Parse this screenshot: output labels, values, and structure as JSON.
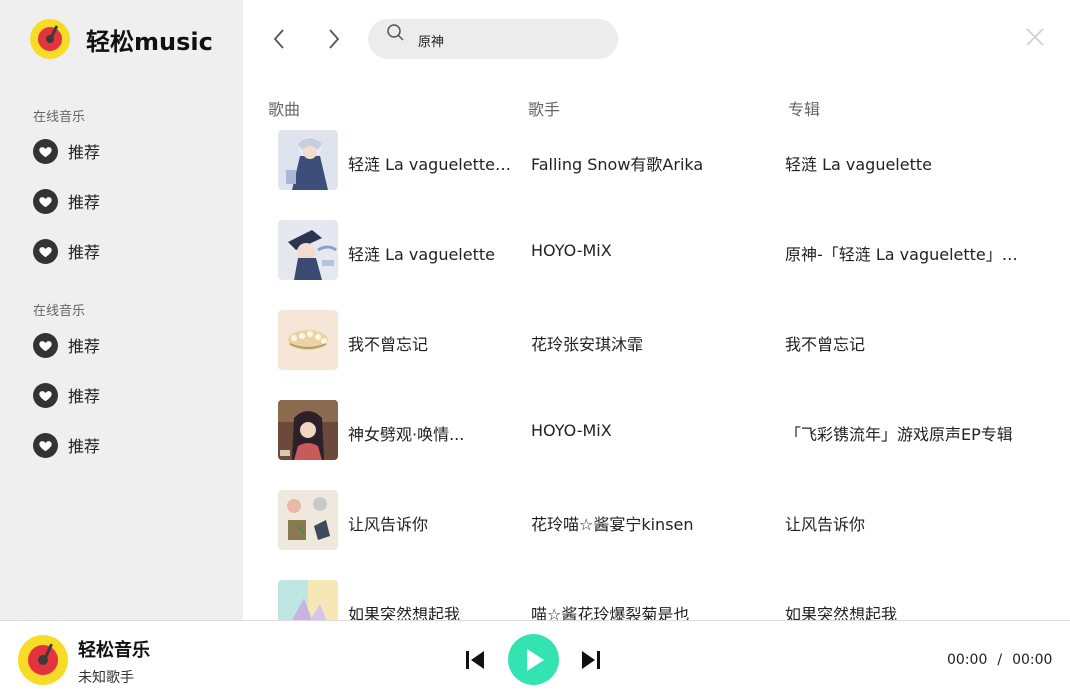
{
  "app": {
    "name": "轻松music"
  },
  "sidebar": {
    "sections": [
      {
        "title": "在线音乐",
        "items": [
          {
            "label": "推荐"
          },
          {
            "label": "推荐"
          },
          {
            "label": "推荐"
          }
        ]
      },
      {
        "title": "在线音乐",
        "items": [
          {
            "label": "推荐"
          },
          {
            "label": "推荐"
          },
          {
            "label": "推荐"
          }
        ]
      }
    ]
  },
  "search": {
    "value": "原神",
    "placeholder": ""
  },
  "table": {
    "headers": {
      "song": "歌曲",
      "artist": "歌手",
      "album": "专辑"
    },
    "rows": [
      {
        "song": "轻涟 La vaguelette法...",
        "artist": "Falling Snow有歌Arika",
        "album": "轻涟 La vaguelette"
      },
      {
        "song": "轻涟 La vaguelette",
        "artist": "HOYO-MiX",
        "album": "原神-「轻涟 La vaguelette」游..."
      },
      {
        "song": "我不曾忘记",
        "artist": "花玲张安琪沐霏",
        "album": "我不曾忘记"
      },
      {
        "song": "神女劈观·唤情...",
        "artist": "HOYO-MiX",
        "album": "「飞彩镌流年」游戏原声EP专辑"
      },
      {
        "song": "让风告诉你",
        "artist": "花玲喵☆酱宴宁kinsen",
        "album": "让风告诉你"
      },
      {
        "song": "如果突然想起我",
        "artist": "喵☆酱花玲爆裂菊是也",
        "album": "如果突然想起我"
      }
    ]
  },
  "player": {
    "title": "轻松音乐",
    "artist": "未知歌手",
    "current_time": "00:00",
    "separator": "/",
    "total_time": "00:00"
  },
  "colors": {
    "accent": "#34e3b2",
    "sidebar_bg": "#efefef",
    "logo_yellow": "#f7dc27",
    "logo_red": "#e5323f"
  }
}
